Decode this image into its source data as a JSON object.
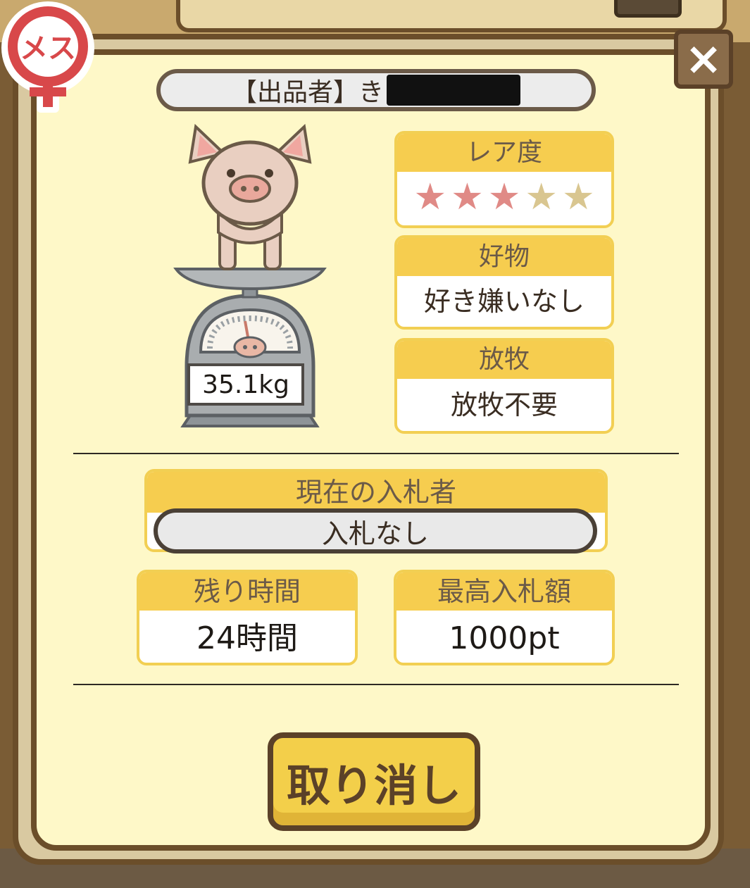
{
  "dialog": {
    "close_label": "×",
    "gender_badge": "メス",
    "seller": {
      "label": "【出品者】き"
    },
    "weight": "35.1kg",
    "rarity": {
      "header": "レア度",
      "stars_filled": 3,
      "stars_total": 5
    },
    "favorite": {
      "header": "好物",
      "value": "好き嫌いなし"
    },
    "grazing": {
      "header": "放牧",
      "value": "放牧不要"
    },
    "current_bidder": {
      "header": "現在の入札者",
      "value": "入札なし"
    },
    "remaining_time": {
      "header": "残り時間",
      "value": "24時間"
    },
    "highest_bid": {
      "header": "最高入札額",
      "value": "1000pt"
    },
    "cancel_button": "取り消し"
  },
  "colors": {
    "accent": "#f6cd4f",
    "frame": "#6b4e2a",
    "panel": "#fef8c8",
    "star_filled": "#e08a86",
    "star_empty": "#d9c690"
  }
}
